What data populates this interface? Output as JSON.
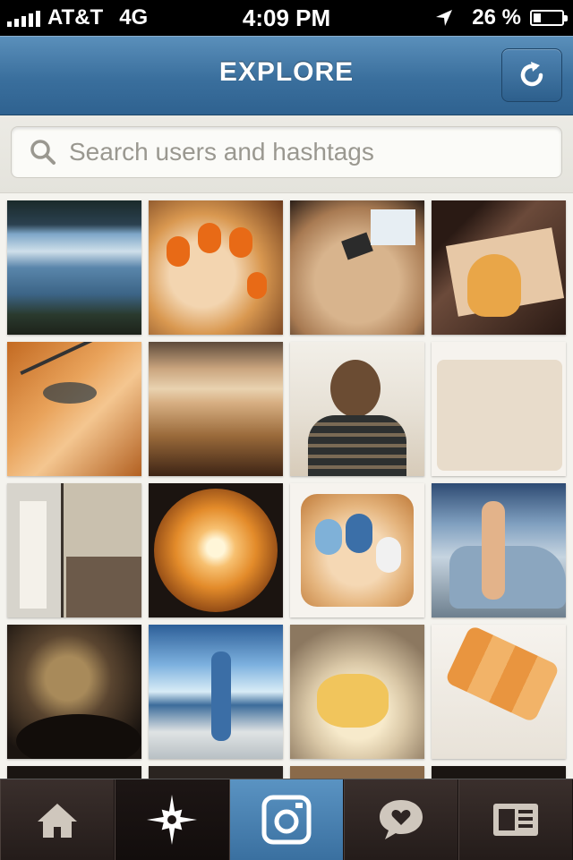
{
  "status_bar": {
    "carrier": "AT&T",
    "network": "4G",
    "time": "4:09 PM",
    "battery_percent": "26 %",
    "battery_level": 0.26,
    "icons": [
      "signal-bars-icon",
      "location-arrow-icon",
      "battery-icon"
    ]
  },
  "header": {
    "title": "EXPLORE",
    "refresh_icon": "refresh-icon",
    "accent": "#3a6f9d"
  },
  "search": {
    "placeholder": "Search users and hashtags",
    "value": "",
    "icon": "search-icon"
  },
  "grid": {
    "columns": 4,
    "photos": [
      {
        "name": "photo-coastal-cliff-view"
      },
      {
        "name": "photo-ladybug-nail-art"
      },
      {
        "name": "photo-craft-desk"
      },
      {
        "name": "photo-cartoon-screen"
      },
      {
        "name": "photo-face-sketch"
      },
      {
        "name": "photo-beach-sunset-people"
      },
      {
        "name": "photo-girl-portrait"
      },
      {
        "name": "photo-cupcakes-box"
      },
      {
        "name": "photo-fashion-collage"
      },
      {
        "name": "photo-sun-fisheye"
      },
      {
        "name": "photo-blue-nail-art"
      },
      {
        "name": "photo-woman-by-car"
      },
      {
        "name": "photo-abstract-shadow"
      },
      {
        "name": "photo-woman-waterfront"
      },
      {
        "name": "photo-dessert-plate"
      },
      {
        "name": "photo-macarons-box"
      },
      {
        "name": "photo-partial-1"
      },
      {
        "name": "photo-partial-2"
      },
      {
        "name": "photo-partial-3"
      },
      {
        "name": "photo-partial-4"
      }
    ]
  },
  "tab_bar": {
    "tabs": [
      {
        "id": "home",
        "icon": "home-icon"
      },
      {
        "id": "explore",
        "icon": "compass-star-icon",
        "selected": true
      },
      {
        "id": "camera",
        "icon": "camera-icon"
      },
      {
        "id": "news",
        "icon": "speech-bubble-heart-icon"
      },
      {
        "id": "profile",
        "icon": "profile-card-icon"
      }
    ]
  }
}
